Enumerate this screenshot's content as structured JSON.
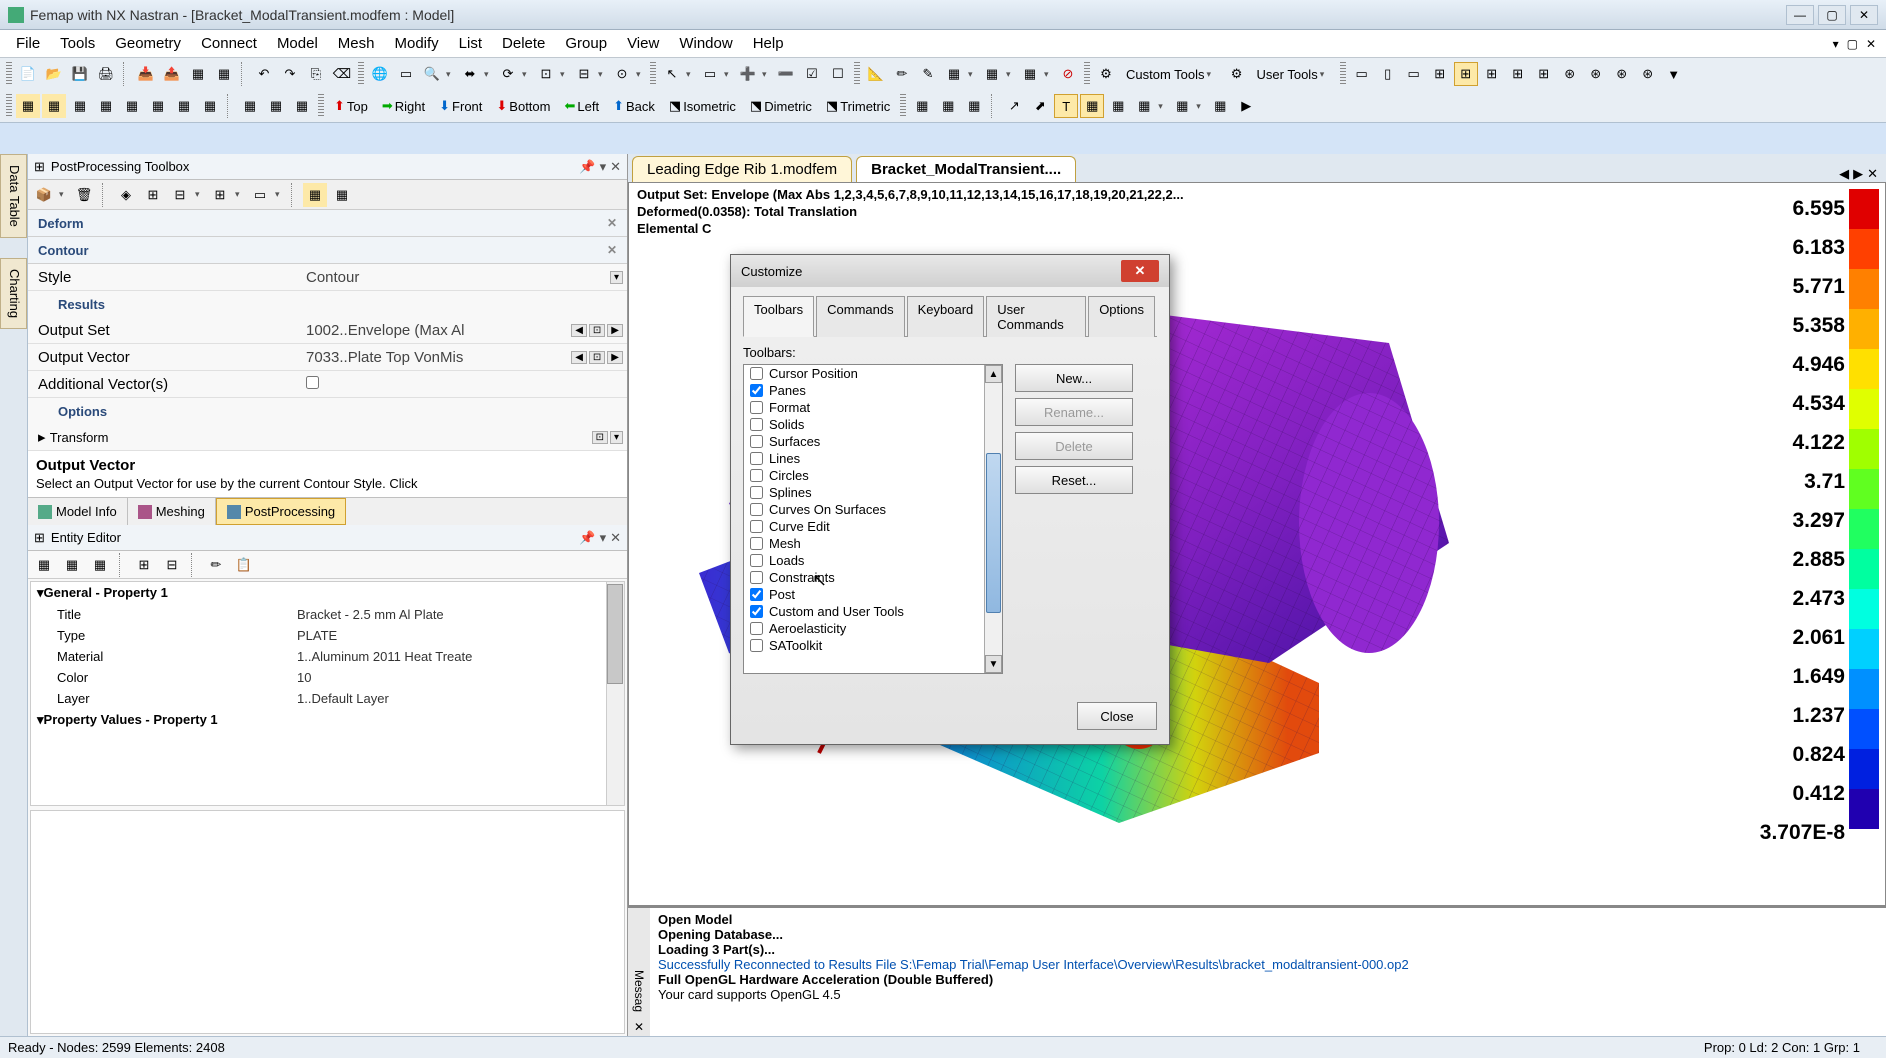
{
  "title": "Femap with NX Nastran - [Bracket_ModalTransient.modfem : Model]",
  "menu": [
    "File",
    "Tools",
    "Geometry",
    "Connect",
    "Model",
    "Mesh",
    "Modify",
    "List",
    "Delete",
    "Group",
    "View",
    "Window",
    "Help"
  ],
  "view_toolbar": {
    "top": "Top",
    "right": "Right",
    "front": "Front",
    "bottom": "Bottom",
    "left": "Left",
    "back": "Back",
    "iso": "Isometric",
    "dim": "Dimetric",
    "tri": "Trimetric"
  },
  "custom_tools": "Custom Tools",
  "user_tools": "User Tools",
  "post_toolbox": {
    "title": "PostProcessing Toolbox",
    "deform": "Deform",
    "contour": "Contour",
    "style_lbl": "Style",
    "style_val": "Contour",
    "results": "Results",
    "outset_lbl": "Output Set",
    "outset_val": "1002..Envelope (Max Al",
    "outvec_lbl": "Output Vector",
    "outvec_val": "7033..Plate Top VonMis",
    "addvec_lbl": "Additional Vector(s)",
    "options": "Options",
    "transform_lbl": "Transform",
    "desc_title": "Output Vector",
    "desc_body": "Select an Output Vector for use by the current Contour Style. Click"
  },
  "bottom_tabs": {
    "model": "Model Info",
    "mesh": "Meshing",
    "post": "PostProcessing"
  },
  "entity": {
    "title": "Entity Editor",
    "general": "General - Property 1",
    "rows": [
      {
        "k": "Title",
        "v": "Bracket - 2.5 mm Al Plate"
      },
      {
        "k": "Type",
        "v": "PLATE"
      },
      {
        "k": "Material",
        "v": "1..Aluminum 2011 Heat Treate"
      },
      {
        "k": "Color",
        "v": "10"
      },
      {
        "k": "Layer",
        "v": "1..Default Layer"
      }
    ],
    "propvals": "Property Values - Property 1"
  },
  "doc_tabs": {
    "other": "Leading Edge Rib 1.modfem",
    "active": "Bracket_ModalTransient...."
  },
  "vp": {
    "l1": "Output Set: Envelope (Max Abs 1,2,3,4,5,6,7,8,9,10,11,12,13,14,15,16,17,18,19,20,21,22,2...",
    "l2": "Deformed(0.0358): Total Translation",
    "l3": "Elemental C"
  },
  "legend": [
    "6.595",
    "6.183",
    "5.771",
    "5.358",
    "4.946",
    "4.534",
    "4.122",
    "3.71",
    "3.297",
    "2.885",
    "2.473",
    "2.061",
    "1.649",
    "1.237",
    "0.824",
    "0.412",
    "3.707E-8"
  ],
  "legend_colors": [
    "#e00000",
    "#ff4000",
    "#ff8000",
    "#ffb000",
    "#ffe000",
    "#e0ff00",
    "#a0ff00",
    "#60ff20",
    "#20ff60",
    "#00ffa0",
    "#00ffe0",
    "#00d0ff",
    "#0090ff",
    "#0050ff",
    "#0020e0",
    "#2000b0"
  ],
  "messages": {
    "side": "Messag",
    "l1": "Open Model",
    "l2": "Opening Database...",
    "l3": "Loading 3 Part(s)...",
    "l4": "Successfully Reconnected to Results File S:\\Femap Trial\\Femap User Interface\\Overview\\Results\\bracket_modaltransient-000.op2",
    "l5": "Full OpenGL Hardware Acceleration (Double Buffered)",
    "l6": "Your card supports OpenGL 4.5"
  },
  "status": {
    "left": "Ready - Nodes: 2599   Elements: 2408",
    "right": "Prop: 0  Ld: 2  Con: 1  Grp: 1"
  },
  "dialog": {
    "title": "Customize",
    "tabs": [
      "Toolbars",
      "Commands",
      "Keyboard",
      "User Commands",
      "Options"
    ],
    "label": "Toolbars:",
    "items": [
      {
        "label": "Cursor Position",
        "checked": false
      },
      {
        "label": "Panes",
        "checked": true
      },
      {
        "label": "Format",
        "checked": false
      },
      {
        "label": "Solids",
        "checked": false
      },
      {
        "label": "Surfaces",
        "checked": false
      },
      {
        "label": "Lines",
        "checked": false
      },
      {
        "label": "Circles",
        "checked": false
      },
      {
        "label": "Splines",
        "checked": false
      },
      {
        "label": "Curves On Surfaces",
        "checked": false
      },
      {
        "label": "Curve Edit",
        "checked": false
      },
      {
        "label": "Mesh",
        "checked": false
      },
      {
        "label": "Loads",
        "checked": false
      },
      {
        "label": "Constraints",
        "checked": false
      },
      {
        "label": "Post",
        "checked": true
      },
      {
        "label": "Custom and User Tools",
        "checked": true
      },
      {
        "label": "Aeroelasticity",
        "checked": false
      },
      {
        "label": "SAToolkit",
        "checked": false
      }
    ],
    "btn_new": "New...",
    "btn_rename": "Rename...",
    "btn_delete": "Delete",
    "btn_reset": "Reset...",
    "btn_close": "Close"
  }
}
